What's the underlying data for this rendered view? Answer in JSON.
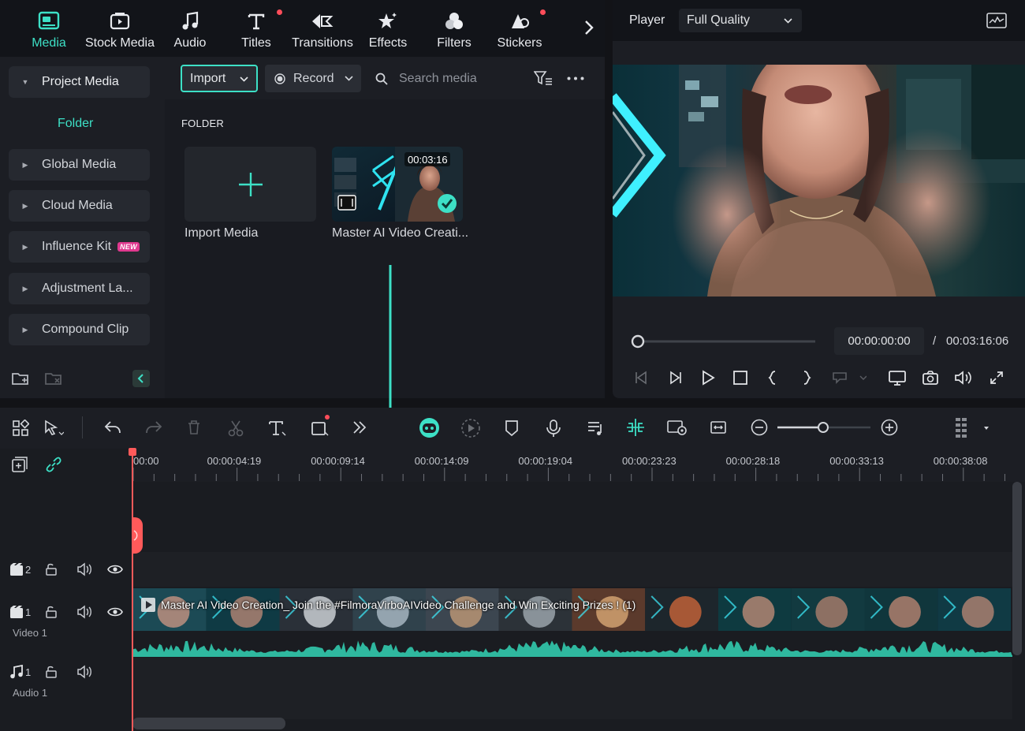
{
  "tabs": [
    {
      "label": "Media",
      "active": true,
      "icon": "media-icon"
    },
    {
      "label": "Stock Media",
      "icon": "stock-media-icon"
    },
    {
      "label": "Audio",
      "icon": "music-note-icon"
    },
    {
      "label": "Titles",
      "icon": "titles-icon",
      "notify": true
    },
    {
      "label": "Transitions",
      "icon": "transitions-icon"
    },
    {
      "label": "Effects",
      "icon": "effects-icon"
    },
    {
      "label": "Filters",
      "icon": "filters-icon"
    },
    {
      "label": "Stickers",
      "icon": "stickers-icon",
      "notify": true
    }
  ],
  "sidebar": {
    "project_media": "Project Media",
    "folder": "Folder",
    "items": [
      {
        "label": "Global Media"
      },
      {
        "label": "Cloud Media"
      },
      {
        "label": "Influence Kit",
        "badge": "NEW"
      },
      {
        "label": "Adjustment La..."
      },
      {
        "label": "Compound Clip"
      }
    ]
  },
  "media_toolbar": {
    "import_label": "Import",
    "record_label": "Record",
    "search_placeholder": "Search media"
  },
  "media": {
    "section_label": "FOLDER",
    "import_card_label": "Import Media",
    "clip_label": "Master AI Video Creati...",
    "clip_duration": "00:03:16"
  },
  "player": {
    "label": "Player",
    "quality": "Full Quality",
    "current_time": "00:00:00:00",
    "separator": "/",
    "total_time": "00:03:16:06"
  },
  "timeline": {
    "ruler_labels": [
      "00:00",
      "00:00:04:19",
      "00:00:09:14",
      "00:00:14:09",
      "00:00:19:04",
      "00:00:23:23",
      "00:00:28:18",
      "00:00:33:13",
      "00:00:38:08"
    ],
    "tracks": {
      "video2_num": "2",
      "video1_num": "1",
      "video1_label": "Video 1",
      "audio1_num": "1",
      "audio1_label": "Audio 1"
    },
    "clip_title": "Master AI Video Creation_ Join the #FilmoraVirboAIVideo Challenge and Win Exciting Prizes ! (1)"
  },
  "colors": {
    "accent": "#3de0c6",
    "notify": "#ff4d5a",
    "playhead": "#ff5a5a",
    "waveform": "#2fb89f"
  }
}
